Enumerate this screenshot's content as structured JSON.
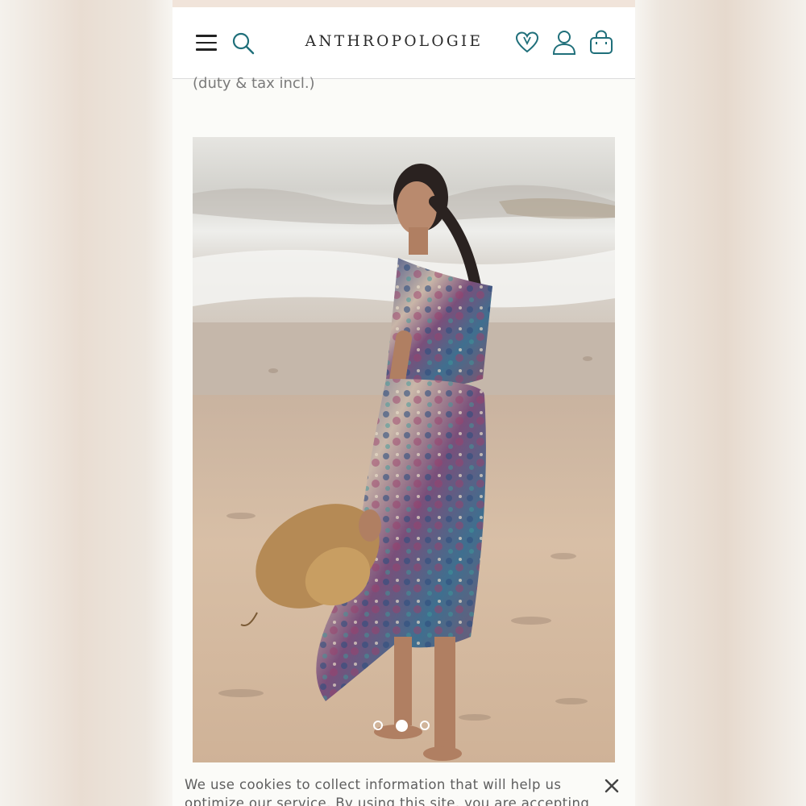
{
  "header": {
    "brand": "ANTHROPOLOGIE",
    "icons": {
      "menu": "hamburger-icon",
      "search": "search-icon",
      "wishlist": "heart-icon",
      "account": "user-icon",
      "bag": "shopping-bag-icon"
    },
    "accent_color": "#1f6f7a"
  },
  "product": {
    "price_note": "(duty & tax incl.)",
    "image_description_alt": "",
    "carousel": {
      "total": 3,
      "active_index": 1
    }
  },
  "cookie_banner": {
    "text_line1": "We use cookies to collect information that will help us",
    "text_line2": "optimize our service. By using this site, you are accepting",
    "close_icon": "close-icon"
  }
}
